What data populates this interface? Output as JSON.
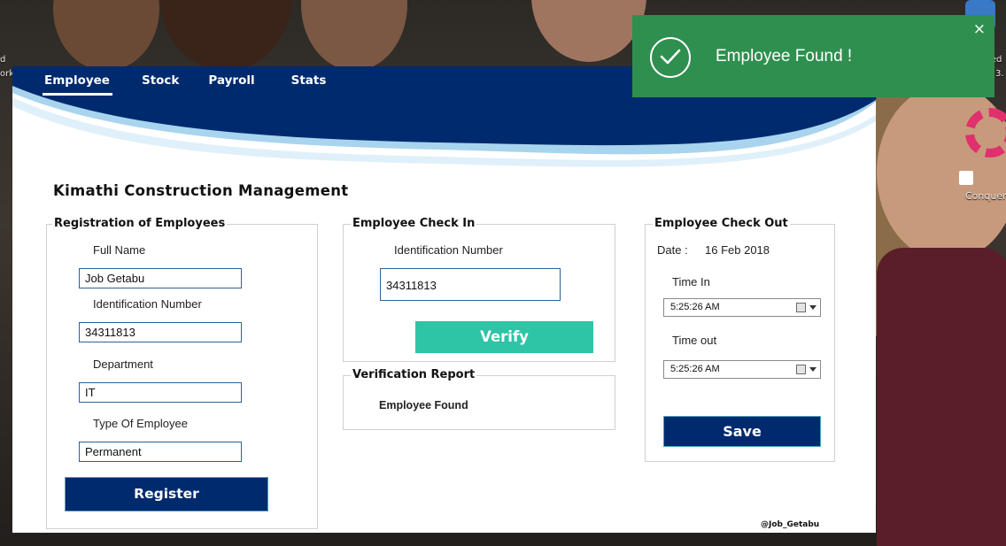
{
  "desktop": {
    "left_icon_labels": [
      "d",
      "ork"
    ],
    "right_icon_labels": [
      "Advanced",
      "3."
    ],
    "conquer_label": "Conquer"
  },
  "app": {
    "tabs": [
      {
        "label": "Employee",
        "active": true
      },
      {
        "label": "Stock",
        "active": false
      },
      {
        "label": "Payroll",
        "active": false
      },
      {
        "label": "Stats",
        "active": false
      }
    ],
    "title": "Kimathi Construction Management",
    "credit": "@Job_Getabu"
  },
  "registration": {
    "title": "Registration of Employees",
    "full_name_label": "Full Name",
    "full_name_value": "Job Getabu",
    "id_label": "Identification Number",
    "id_value": "34311813",
    "department_label": "Department",
    "department_value": "IT",
    "type_label": "Type Of Employee",
    "type_value": "Permanent",
    "register_button": "Register"
  },
  "check_in": {
    "title": "Employee Check In",
    "id_label": "Identification Number",
    "id_value": "34311813",
    "verify_button": "Verify"
  },
  "verification": {
    "title": "Verification Report",
    "result": "Employee Found"
  },
  "check_out": {
    "title": "Employee Check Out",
    "date_label": "Date :",
    "date_value": "16 Feb 2018",
    "time_in_label": "Time In",
    "time_in_value": "5:25:26 AM",
    "time_out_label": "Time out",
    "time_out_value": "5:25:26 AM",
    "save_button": "Save"
  },
  "toast": {
    "message": "Employee Found !",
    "close": "×"
  },
  "colors": {
    "header_navy": "#002a6e",
    "button_navy": "#002a6e",
    "verify_teal": "#2ec4a6",
    "toast_green": "#2f8f4f"
  }
}
